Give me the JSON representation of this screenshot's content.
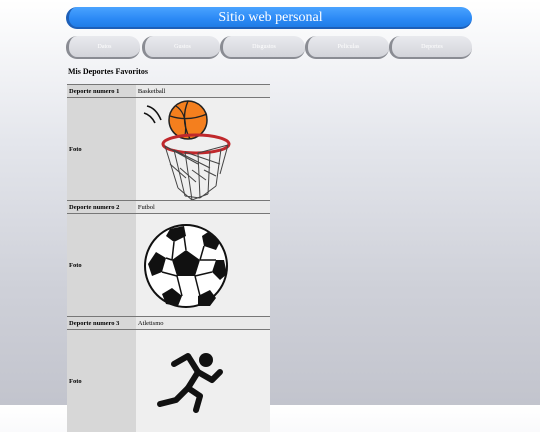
{
  "header": {
    "title": "Sitio web personal"
  },
  "nav": {
    "items": [
      "Datos",
      "Gustos",
      "Disgustos",
      "Peliculas",
      "Deportes"
    ]
  },
  "section": {
    "title": "Mis Deportes Favoritos"
  },
  "sports": [
    {
      "label": "Deporte numero 1",
      "name": "Basketball",
      "photo_label": "Foto",
      "icon": "basketball-hoop-icon"
    },
    {
      "label": "Deporte numero 2",
      "name": "Futbol",
      "photo_label": "Foto",
      "icon": "soccer-ball-icon"
    },
    {
      "label": "Deporte numero 3",
      "name": "Atletismo",
      "photo_label": "Foto",
      "icon": "runner-icon"
    }
  ],
  "colors": {
    "banner": "#2b89f5",
    "tab": "#d3d4da",
    "header_cell": "#d7d7d7"
  }
}
